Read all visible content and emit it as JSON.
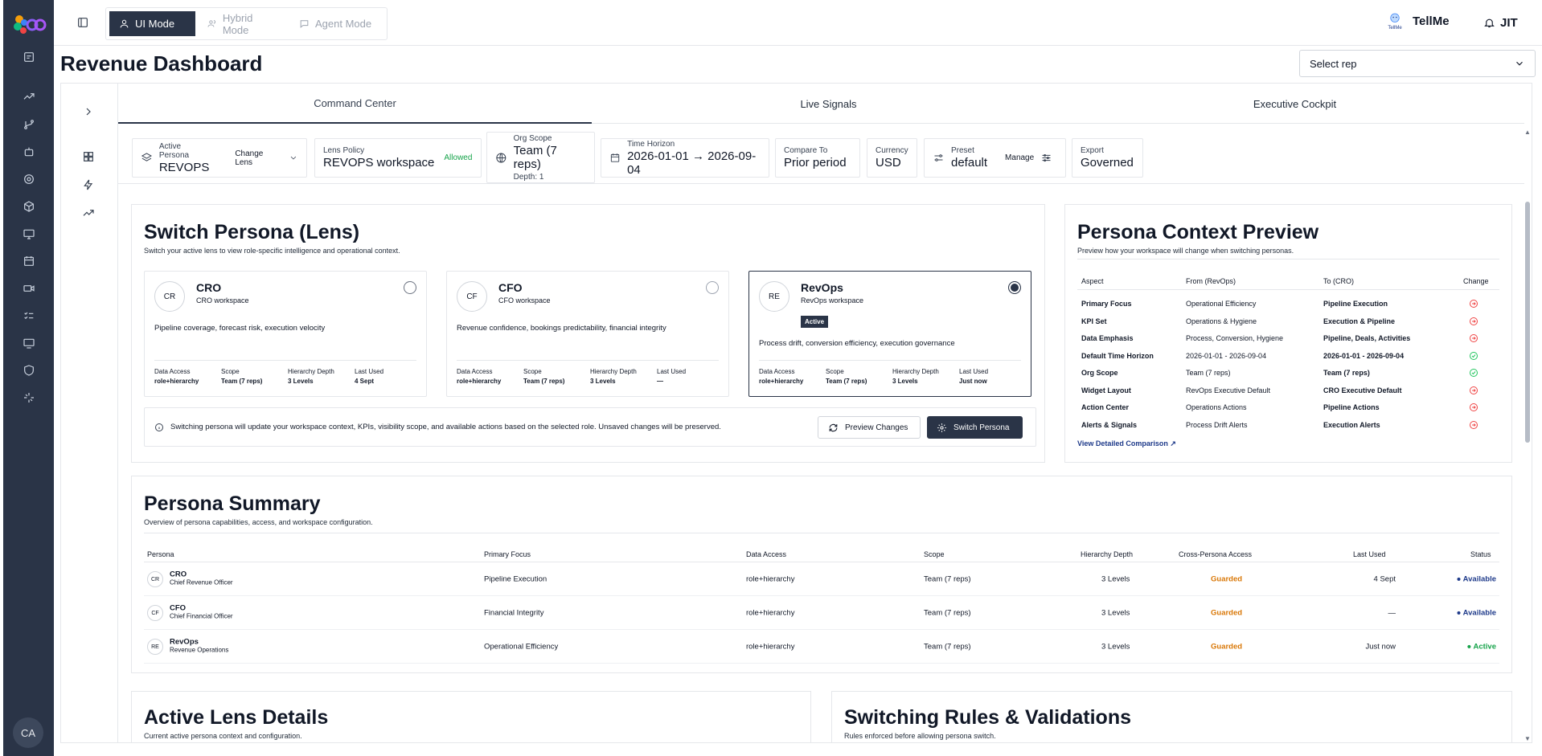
{
  "header": {
    "modes": [
      {
        "label": "UI Mode",
        "active": true
      },
      {
        "label": "Hybrid Mode",
        "active": false
      },
      {
        "label": "Agent Mode",
        "active": false
      }
    ],
    "tellme_label": "TellMe",
    "tellme_icon_caption": "TellMe",
    "jit_label": "JIT"
  },
  "page": {
    "title": "Revenue Dashboard",
    "rep_select": "Select rep"
  },
  "user": {
    "initials": "CA"
  },
  "tabs": [
    "Command Center",
    "Live Signals",
    "Executive Cockpit"
  ],
  "filters": {
    "active_persona": {
      "label": "Active Persona",
      "value": "REVOPS",
      "action": "Change Lens"
    },
    "lens_policy": {
      "label": "Lens Policy",
      "value": "REVOPS workspace",
      "status": "Allowed"
    },
    "org_scope": {
      "label": "Org Scope",
      "value": "Team (7 reps)",
      "depth": "Depth: 1"
    },
    "time_horizon": {
      "label": "Time Horizon",
      "value": "2026-01-01 → 2026-09-04"
    },
    "compare_to": {
      "label": "Compare To",
      "value": "Prior period"
    },
    "currency": {
      "label": "Currency",
      "value": "USD"
    },
    "preset": {
      "label": "Preset",
      "value": "default",
      "action": "Manage"
    },
    "export": {
      "label": "Export",
      "value": "Governed"
    }
  },
  "switch_persona": {
    "title": "Switch Persona (Lens)",
    "subtitle": "Switch your active lens to view role-specific intelligence and operational context.",
    "personas": [
      {
        "initials": "CR",
        "name": "CRO",
        "workspace": "CRO workspace",
        "description": "Pipeline coverage, forecast risk, execution velocity",
        "data_access": "role+hierarchy",
        "scope": "Team (7 reps)",
        "depth": "3 Levels",
        "last_used": "4 Sept",
        "selected": false,
        "active_label": ""
      },
      {
        "initials": "CF",
        "name": "CFO",
        "workspace": "CFO workspace",
        "description": "Revenue confidence, bookings predictability, financial integrity",
        "data_access": "role+hierarchy",
        "scope": "Team (7 reps)",
        "depth": "3 Levels",
        "last_used": "—",
        "selected": false,
        "active_label": ""
      },
      {
        "initials": "RE",
        "name": "RevOps",
        "workspace": "RevOps workspace",
        "description": "Process drift, conversion efficiency, execution governance",
        "data_access": "role+hierarchy",
        "scope": "Team (7 reps)",
        "depth": "3 Levels",
        "last_used": "Just now",
        "selected": true,
        "active_label": "Active"
      }
    ],
    "meta_labels": {
      "data_access": "Data Access",
      "scope": "Scope",
      "depth": "Hierarchy Depth",
      "last_used": "Last Used"
    },
    "info": "Switching persona will update your workspace context, KPIs, visibility scope, and available actions based on the selected role. Unsaved changes will be preserved.",
    "preview_button": "Preview Changes",
    "switch_button": "Switch Persona"
  },
  "context_preview": {
    "title": "Persona Context Preview",
    "subtitle": "Preview how your workspace will change when switching personas.",
    "columns": [
      "Aspect",
      "From (RevOps)",
      "To (CRO)",
      "Change"
    ],
    "rows": [
      {
        "aspect": "Primary Focus",
        "from": "Operational Efficiency",
        "to": "Pipeline Execution",
        "change": "changed"
      },
      {
        "aspect": "KPI Set",
        "from": "Operations & Hygiene",
        "to": "Execution & Pipeline",
        "change": "changed"
      },
      {
        "aspect": "Data Emphasis",
        "from": "Process, Conversion, Hygiene",
        "to": "Pipeline, Deals, Activities",
        "change": "changed"
      },
      {
        "aspect": "Default Time Horizon",
        "from": "2026-01-01 - 2026-09-04",
        "to": "2026-01-01 - 2026-09-04",
        "change": "same"
      },
      {
        "aspect": "Org Scope",
        "from": "Team (7 reps)",
        "to": "Team (7 reps)",
        "change": "same"
      },
      {
        "aspect": "Widget Layout",
        "from": "RevOps Executive Default",
        "to": "CRO Executive Default",
        "change": "changed"
      },
      {
        "aspect": "Action Center",
        "from": "Operations Actions",
        "to": "Pipeline Actions",
        "change": "changed"
      },
      {
        "aspect": "Alerts & Signals",
        "from": "Process Drift Alerts",
        "to": "Execution Alerts",
        "change": "changed"
      }
    ],
    "link": "View Detailed Comparison",
    "colors": {
      "changed": "#ef4444",
      "same": "#22c55e"
    }
  },
  "summary": {
    "title": "Persona Summary",
    "subtitle": "Overview of persona capabilities, access, and workspace configuration.",
    "columns": [
      "Persona",
      "Primary Focus",
      "Data Access",
      "Scope",
      "Hierarchy Depth",
      "Cross-Persona Access",
      "Last Used",
      "Status"
    ],
    "rows": [
      {
        "initials": "CR",
        "name": "CRO",
        "role": "Chief Revenue Officer",
        "focus": "Pipeline Execution",
        "access": "role+hierarchy",
        "scope": "Team (7 reps)",
        "depth": "3 Levels",
        "cross": "Guarded",
        "last": "4 Sept",
        "status": "Available"
      },
      {
        "initials": "CF",
        "name": "CFO",
        "role": "Chief Financial Officer",
        "focus": "Financial Integrity",
        "access": "role+hierarchy",
        "scope": "Team (7 reps)",
        "depth": "3 Levels",
        "cross": "Guarded",
        "last": "—",
        "status": "Available"
      },
      {
        "initials": "RE",
        "name": "RevOps",
        "role": "Revenue Operations",
        "focus": "Operational Efficiency",
        "access": "role+hierarchy",
        "scope": "Team (7 reps)",
        "depth": "3 Levels",
        "cross": "Guarded",
        "last": "Just now",
        "status": "Active"
      }
    ]
  },
  "active_lens": {
    "title": "Active Lens Details",
    "subtitle": "Current active persona context and configuration."
  },
  "rules": {
    "title": "Switching Rules & Validations",
    "subtitle": "Rules enforced before allowing persona switch."
  },
  "colors": {
    "brand_dark": "#2a3447",
    "allowed": "#16a34a",
    "guarded": "#d97706"
  }
}
